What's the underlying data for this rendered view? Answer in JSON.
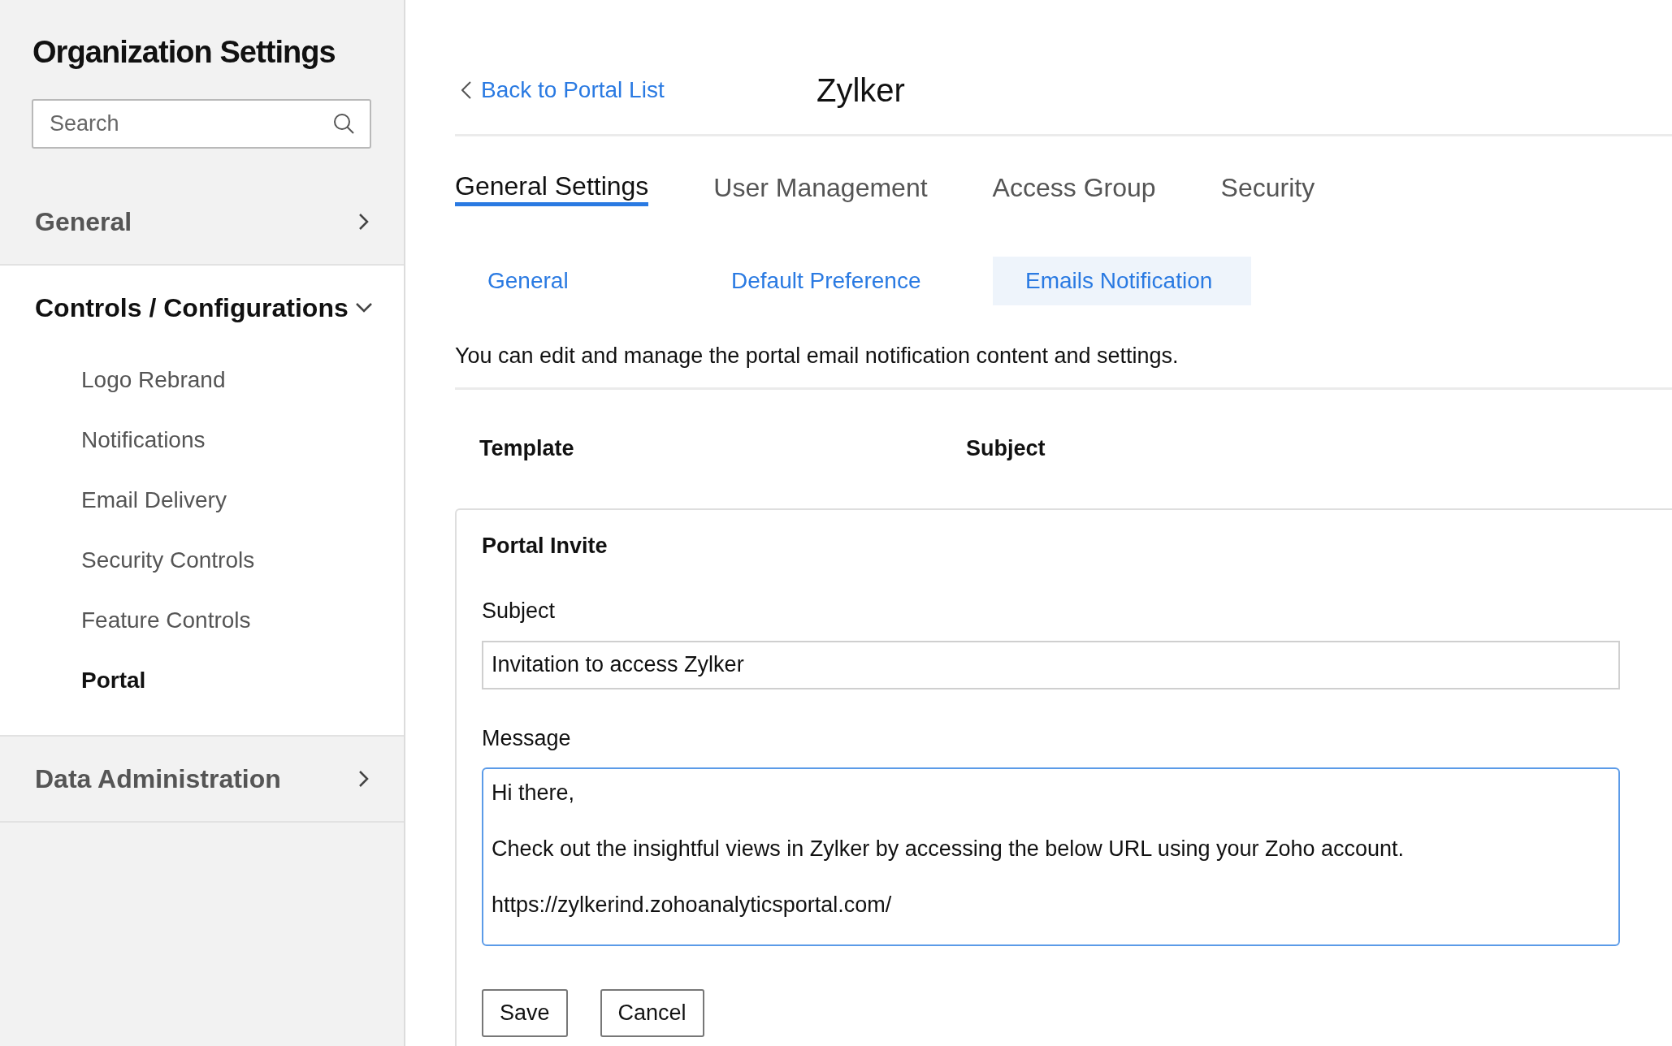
{
  "sidebar": {
    "title": "Organization Settings",
    "search": {
      "placeholder": "Search"
    },
    "sections": [
      {
        "label": "General",
        "expanded": false
      },
      {
        "label": "Controls / Configurations",
        "expanded": true,
        "items": [
          {
            "label": "Logo Rebrand",
            "selected": false
          },
          {
            "label": "Notifications",
            "selected": false
          },
          {
            "label": "Email Delivery",
            "selected": false
          },
          {
            "label": "Security Controls",
            "selected": false
          },
          {
            "label": "Feature Controls",
            "selected": false
          },
          {
            "label": "Portal",
            "selected": true
          }
        ]
      },
      {
        "label": "Data Administration",
        "expanded": false
      }
    ]
  },
  "header": {
    "back_link": "Back to Portal List",
    "title": "Zylker"
  },
  "tabs": [
    {
      "label": "General Settings",
      "selected": true
    },
    {
      "label": "User Management",
      "selected": false
    },
    {
      "label": "Access Group",
      "selected": false
    },
    {
      "label": "Security",
      "selected": false
    }
  ],
  "subtabs": [
    {
      "label": "General",
      "selected": false
    },
    {
      "label": "Default Preference",
      "selected": false
    },
    {
      "label": "Emails Notification",
      "selected": true
    }
  ],
  "description": "You can edit and manage the portal email notification content and settings.",
  "columns": [
    "Template",
    "Subject"
  ],
  "card": {
    "title": "Portal Invite",
    "subject_label": "Subject",
    "subject_value": "Invitation to access Zylker",
    "message_label": "Message",
    "message_value": "Hi there,\n\nCheck out the insightful views in Zylker by accessing the below URL using your Zoho account.\n\nhttps://zylkerind.zohoanalyticsportal.com/",
    "buttons": [
      "Save",
      "Cancel"
    ]
  }
}
